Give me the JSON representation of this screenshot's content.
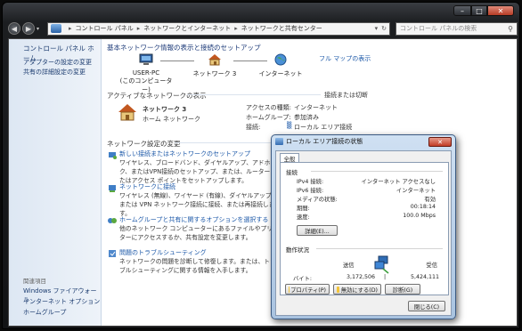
{
  "window": {
    "caption_min": "–",
    "caption_max": "□",
    "caption_close": "✕"
  },
  "address_bar": {
    "back": "◀",
    "forward": "▶",
    "crumbs": [
      "コントロール パネル",
      "ネットワークとインターネット",
      "ネットワークと共有センター"
    ],
    "separator": "▸",
    "dropdown": "▾",
    "refresh": "↻"
  },
  "search": {
    "placeholder": "コントロール パネルの検索"
  },
  "sidebar": {
    "home": "コントロール パネル ホーム",
    "items": [
      "アダプターの設定の変更",
      "共有の詳細設定の変更"
    ],
    "see_also_title": "関連項目",
    "see_also": [
      "Windows ファイアウォール",
      "インターネット オプション",
      "ホームグループ"
    ]
  },
  "main": {
    "heading": "基本ネットワーク情報の表示と接続のセットアップ",
    "full_map": "フル マップの表示",
    "map_nodes": [
      {
        "label": "USER-PC",
        "sublabel": "(このコンピューター)"
      },
      {
        "label": "ネットワーク 3",
        "sublabel": ""
      },
      {
        "label": "インターネット",
        "sublabel": ""
      }
    ],
    "active_networks_title": "アクティブなネットワークの表示",
    "connect_disconnect": "接続または切断",
    "network_name": "ネットワーク 3",
    "network_type": "ホーム ネットワーク",
    "access_type_label": "アクセスの種類:",
    "access_type_value": "インターネット",
    "homegroup_label": "ホームグループ:",
    "homegroup_value": "参加済み",
    "connections_label": "接続:",
    "connections_value": "ローカル エリア接続",
    "change_settings_title": "ネットワーク設定の変更",
    "tasks": [
      {
        "link": "新しい接続またはネットワークのセットアップ",
        "desc": "ワイヤレス、ブロードバンド、ダイヤルアップ、アドホック、またはVPN接続のセットアップ、または、ルーターまたはアクセス ポイントをセットアップします。"
      },
      {
        "link": "ネットワークに接続",
        "desc": "ワイヤレス (無線)、ワイヤード (有線)、ダイヤルアップ、または VPN ネットワーク接続に接続、または再接続します。"
      },
      {
        "link": "ホームグループと共有に関するオプションを選択する",
        "desc": "他のネットワーク コンピューターにあるファイルやプリンターにアクセスするか、共有設定を変更します。"
      },
      {
        "link": "問題のトラブルシューティング",
        "desc": "ネットワークの問題を診断して修復します。または、トラブルシューティングに関する情報を入手します。"
      }
    ]
  },
  "dialog": {
    "title": "ローカル エリア接続の状態",
    "close": "✕",
    "tab": "全般",
    "connection_group": "接続",
    "rows": [
      {
        "label": "IPv4 接続:",
        "value": "インターネット アクセスなし"
      },
      {
        "label": "IPv6 接続:",
        "value": "インターネット"
      },
      {
        "label": "メディアの状態:",
        "value": "有効"
      },
      {
        "label": "期間:",
        "value": "00:18:14"
      },
      {
        "label": "速度:",
        "value": "100.0 Mbps"
      }
    ],
    "details_button": "詳細(E)...",
    "activity_group": "動作状況",
    "sent_label": "送信",
    "received_label": "受信",
    "bytes_label": "バイト:",
    "bytes_sent": "3,172,506",
    "bytes_received": "5,424,111",
    "properties_button": "プロパティ(P)",
    "disable_button": "無効にする(D)",
    "diagnose_button": "診断(G)",
    "close_button": "閉じる(C)"
  }
}
